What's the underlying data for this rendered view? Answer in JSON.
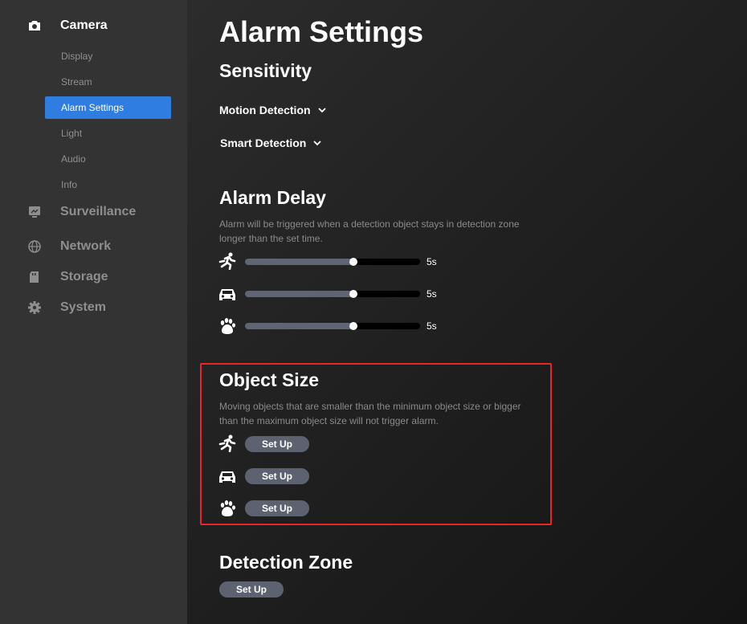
{
  "sidebar": {
    "camera": {
      "label": "Camera",
      "icon": "camera-icon",
      "items": [
        {
          "label": "Display"
        },
        {
          "label": "Stream"
        },
        {
          "label": "Alarm Settings",
          "selected": true
        },
        {
          "label": "Light"
        },
        {
          "label": "Audio"
        },
        {
          "label": "Info"
        }
      ]
    },
    "sections": [
      {
        "label": "Surveillance",
        "icon": "monitor-icon"
      },
      {
        "label": "Network",
        "icon": "globe-icon"
      },
      {
        "label": "Storage",
        "icon": "sd-card-icon"
      },
      {
        "label": "System",
        "icon": "gear-icon"
      }
    ],
    "accent_color": "#2f7de1"
  },
  "main": {
    "title": "Alarm Settings",
    "sensitivity": {
      "heading": "Sensitivity",
      "motion_detection": "Motion Detection",
      "smart_detection": "Smart Detection"
    },
    "alarm_delay": {
      "heading": "Alarm Delay",
      "description": "Alarm will be triggered when a detection object stays in detection zone longer than the set time.",
      "rows": [
        {
          "icon": "running-person-icon",
          "value": "5s",
          "level": 0.62
        },
        {
          "icon": "car-icon",
          "value": "5s",
          "level": 0.62
        },
        {
          "icon": "paw-icon",
          "value": "5s",
          "level": 0.62
        }
      ]
    },
    "object_size": {
      "heading": "Object Size",
      "description": "Moving objects that are smaller than the minimum object size or bigger than the maximum object size will not trigger alarm.",
      "rows": [
        {
          "icon": "running-person-icon",
          "button": "Set Up"
        },
        {
          "icon": "car-icon",
          "button": "Set Up"
        },
        {
          "icon": "paw-icon",
          "button": "Set Up"
        }
      ],
      "highlight_color": "#e8262a"
    },
    "detection_zone": {
      "heading": "Detection Zone",
      "button": "Set Up"
    }
  }
}
